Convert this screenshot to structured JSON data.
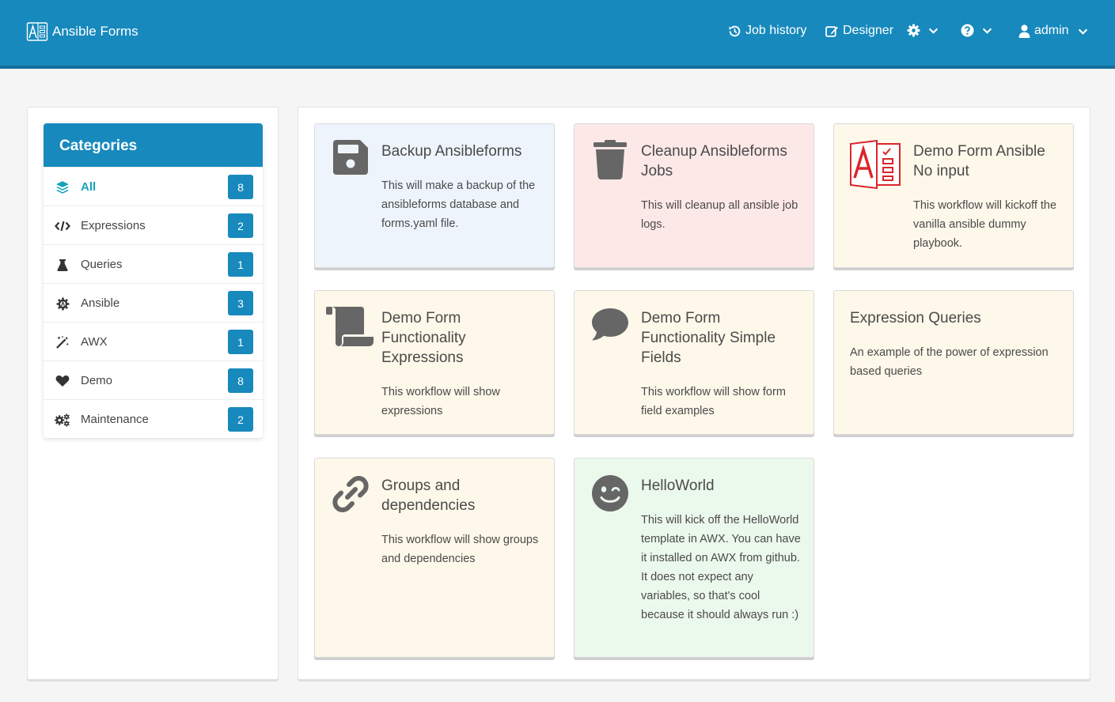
{
  "brand": {
    "name": "Ansible Forms"
  },
  "nav": {
    "job_history": "Job history",
    "designer": "Designer",
    "user": "admin"
  },
  "categories": {
    "title": "Categories",
    "items": [
      {
        "label": "All",
        "count": "8",
        "icon": "layer-group-icon",
        "active": true
      },
      {
        "label": "Expressions",
        "count": "2",
        "icon": "code-icon"
      },
      {
        "label": "Queries",
        "count": "1",
        "icon": "flask-icon"
      },
      {
        "label": "Ansible",
        "count": "3",
        "icon": "ansible-gear-icon"
      },
      {
        "label": "AWX",
        "count": "1",
        "icon": "magic-wand-icon"
      },
      {
        "label": "Demo",
        "count": "8",
        "icon": "heart-icon"
      },
      {
        "label": "Maintenance",
        "count": "2",
        "icon": "cogs-icon"
      }
    ]
  },
  "forms": [
    {
      "title": "Backup Ansibleforms",
      "description": "This will make a backup of the ansibleforms database and forms.yaml file.",
      "icon": "floppy-disk-icon",
      "color": "#eef4fc"
    },
    {
      "title": "Cleanup Ansibleforms Jobs",
      "description": "This will cleanup all ansible job logs.",
      "icon": "trash-icon",
      "color": "#fde8e8"
    },
    {
      "title": "Demo Form Ansible No input",
      "description": "This workflow will kickoff the vanilla ansible dummy playbook.",
      "icon": "ansible-forms-logo-icon",
      "color": "#fef8ea"
    },
    {
      "title": "Demo Form Functionality Expressions",
      "description": "This workflow will show expressions",
      "icon": "scroll-icon",
      "color": "#fef8ea"
    },
    {
      "title": "Demo Form Functionality Simple Fields",
      "description": "This workflow will show form field examples",
      "icon": "comment-icon",
      "color": "#fef8ea"
    },
    {
      "title": "Expression Queries",
      "description": "An example of the power of expression based queries",
      "icon": "",
      "color": "#fef8ea"
    },
    {
      "title": "Groups and dependencies",
      "description": "This workflow will show groups and dependencies",
      "icon": "link-icon",
      "color": "#fef8ea"
    },
    {
      "title": "HelloWorld",
      "description": "This will kick off the HelloWorld template in AWX. You can have it installed on AWX from github. It does not expect any variables, so that's cool because it should always run :)",
      "icon": "smile-wink-icon",
      "color": "#ebf8ec"
    }
  ],
  "colors": {
    "primary": "#1789bd",
    "active": "#17a2b8",
    "icon_gray": "#666666",
    "ansible_red": "#d9262c"
  }
}
